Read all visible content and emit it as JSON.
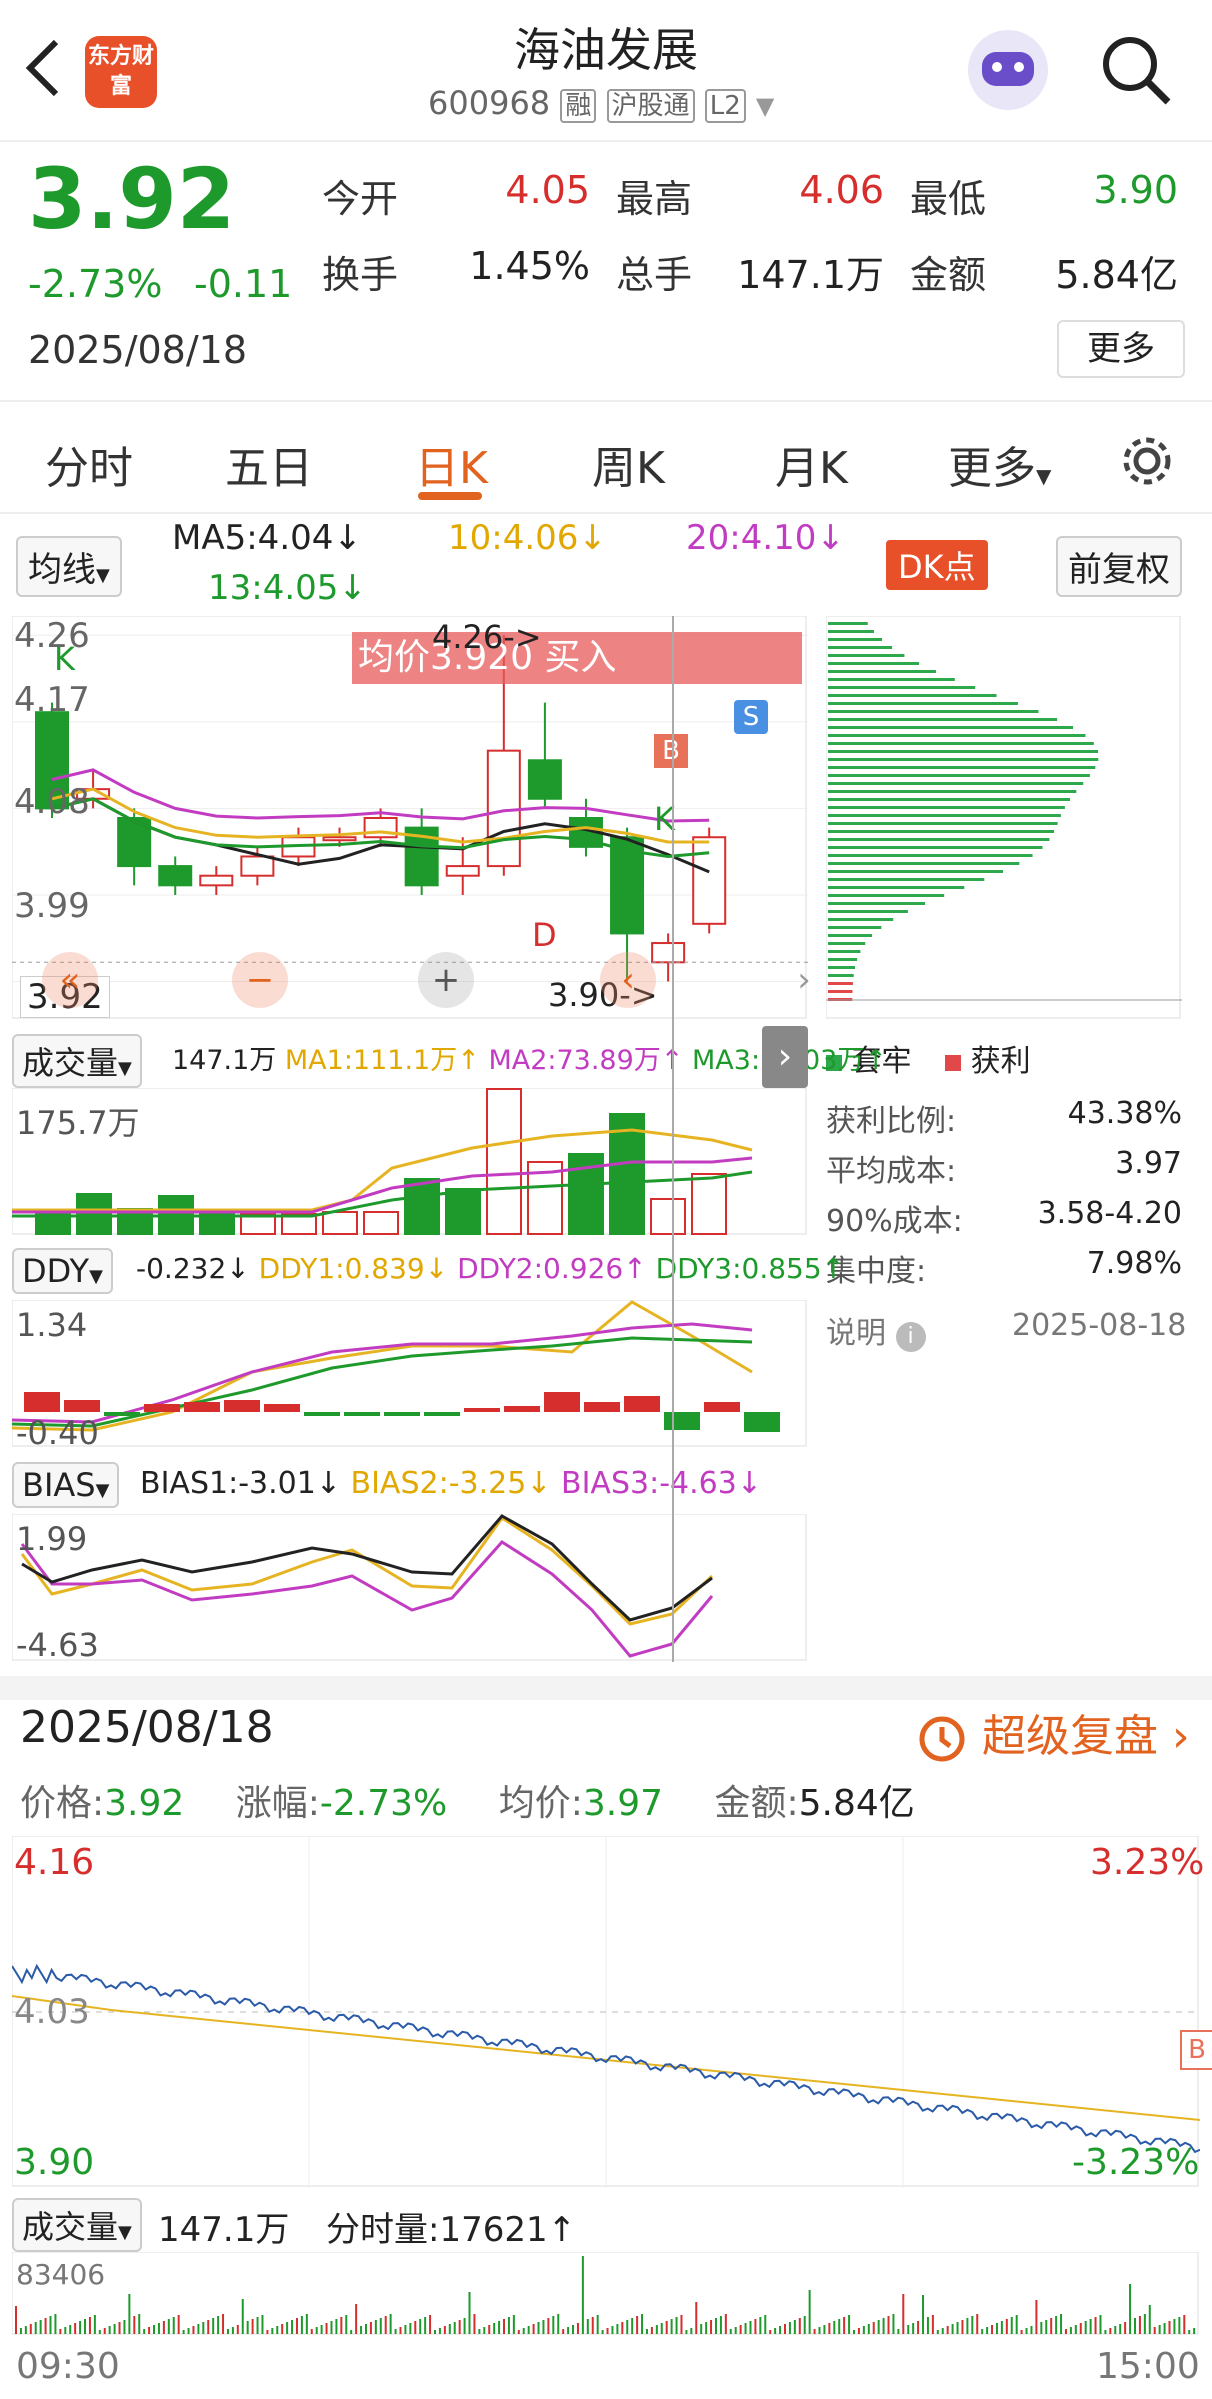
{
  "header": {
    "title": "海油发展",
    "code": "600968",
    "tag_rong": "融",
    "tag_hgt": "沪股通",
    "tag_l2": "L2",
    "logo_text": "东方财富"
  },
  "quote": {
    "price": "3.92",
    "change_pct": "-2.73%",
    "change": "-0.11",
    "date": "2025/08/18",
    "stats": [
      {
        "label": "今开",
        "value": "4.05",
        "color": "#d62d2d"
      },
      {
        "label": "最高",
        "value": "4.06",
        "color": "#d62d2d"
      },
      {
        "label": "最低",
        "value": "3.90",
        "color": "#1e9a2c"
      },
      {
        "label": "换手",
        "value": "1.45%",
        "color": "#222"
      },
      {
        "label": "总手",
        "value": "147.1万",
        "color": "#222"
      },
      {
        "label": "金额",
        "value": "5.84亿",
        "color": "#222"
      }
    ],
    "more": "更多"
  },
  "tabs": [
    {
      "label": "分时"
    },
    {
      "label": "五日"
    },
    {
      "label": "日K"
    },
    {
      "label": "周K"
    },
    {
      "label": "月K"
    },
    {
      "label": "更多"
    }
  ],
  "ma_bar": {
    "selector": "均线",
    "ma5": "MA5:4.04↓",
    "ma10": "10:4.06↓",
    "ma20": "20:4.10↓",
    "ma13": "13:4.05↓",
    "dk": "DK点",
    "fq": "前复权"
  },
  "kline": {
    "y_labels": [
      "4.26",
      "4.17",
      "4.08",
      "3.99",
      "3.92"
    ],
    "avg_banner": "均价3.920  买入",
    "hi_mark": "4.26->",
    "lo_mark": "3.90->",
    "b_mark": "B",
    "s_mark": "S",
    "d_mark": "D",
    "k_mark": "K",
    "k_mark2": "K",
    "candles": [
      [
        4.18,
        4.08,
        4.19,
        4.07
      ],
      [
        4.09,
        4.1,
        4.12,
        4.08
      ],
      [
        4.07,
        4.02,
        4.08,
        4.0
      ],
      [
        4.02,
        4.0,
        4.03,
        3.99
      ],
      [
        4.0,
        4.01,
        4.02,
        3.99
      ],
      [
        4.01,
        4.03,
        4.04,
        4.0
      ],
      [
        4.03,
        4.05,
        4.06,
        4.02
      ],
      [
        4.05,
        4.05,
        4.06,
        4.04
      ],
      [
        4.05,
        4.07,
        4.08,
        4.04
      ],
      [
        4.06,
        4.0,
        4.08,
        3.99
      ],
      [
        4.01,
        4.02,
        4.05,
        3.99
      ],
      [
        4.02,
        4.14,
        4.26,
        4.01
      ],
      [
        4.13,
        4.09,
        4.19,
        4.08
      ],
      [
        4.07,
        4.04,
        4.09,
        4.03
      ],
      [
        4.05,
        3.95,
        4.06,
        3.9
      ],
      [
        3.92,
        3.94,
        3.95,
        3.9
      ],
      [
        3.96,
        4.05,
        4.06,
        3.95
      ]
    ]
  },
  "volume": {
    "selector": "成交量",
    "vol": "147.1万",
    "ma1": "MA1:111.1万↑",
    "ma2": "MA2:73.89万↑",
    "ma3": "MA3:55.03万↑",
    "ylab": "175.7万"
  },
  "ddy": {
    "selector": "DDY",
    "v": "-0.232↓",
    "d1": "DDY1:0.839↓",
    "d2": "DDY2:0.926↑",
    "d3": "DDY3:0.855↑",
    "ytop": "1.34",
    "ybot": "-0.40"
  },
  "bias": {
    "selector": "BIAS",
    "b1": "BIAS1:-3.01↓",
    "b2": "BIAS2:-3.25↓",
    "b3": "BIAS3:-4.63↓",
    "ytop": "1.99",
    "ybot": "-4.63"
  },
  "chips": {
    "legend_trap": "套牢",
    "legend_profit": "获利",
    "rows": [
      {
        "k": "获利比例:",
        "v": "43.38%"
      },
      {
        "k": "平均成本:",
        "v": "3.97"
      },
      {
        "k": "90%成本:",
        "v": "3.58-4.20"
      },
      {
        "k": "集中度:",
        "v": "7.98%"
      }
    ],
    "note": "说明",
    "note_date": "2025-08-18"
  },
  "intraday": {
    "date": "2025/08/18",
    "replay": "超级复盘",
    "price_lbl": "价格:",
    "price": "3.92",
    "chg_lbl": "涨幅:",
    "chg": "-2.73%",
    "avg_lbl": "均价:",
    "avg": "3.97",
    "amt_lbl": "金额:",
    "amt": "5.84亿",
    "y_top": "4.16",
    "y_mid": "4.03",
    "y_bot": "3.90",
    "pct_top": "3.23%",
    "pct_bot": "-3.23%",
    "b_mark": "B",
    "vol_selector": "成交量",
    "vol": "147.1万",
    "tick_vol": "分时量:17621↑",
    "vol_max": "83406",
    "t_start": "09:30",
    "t_end": "15:00"
  },
  "colors": {
    "up": "#d62d2d",
    "down": "#1e9a2c",
    "accent": "#e2621f"
  }
}
